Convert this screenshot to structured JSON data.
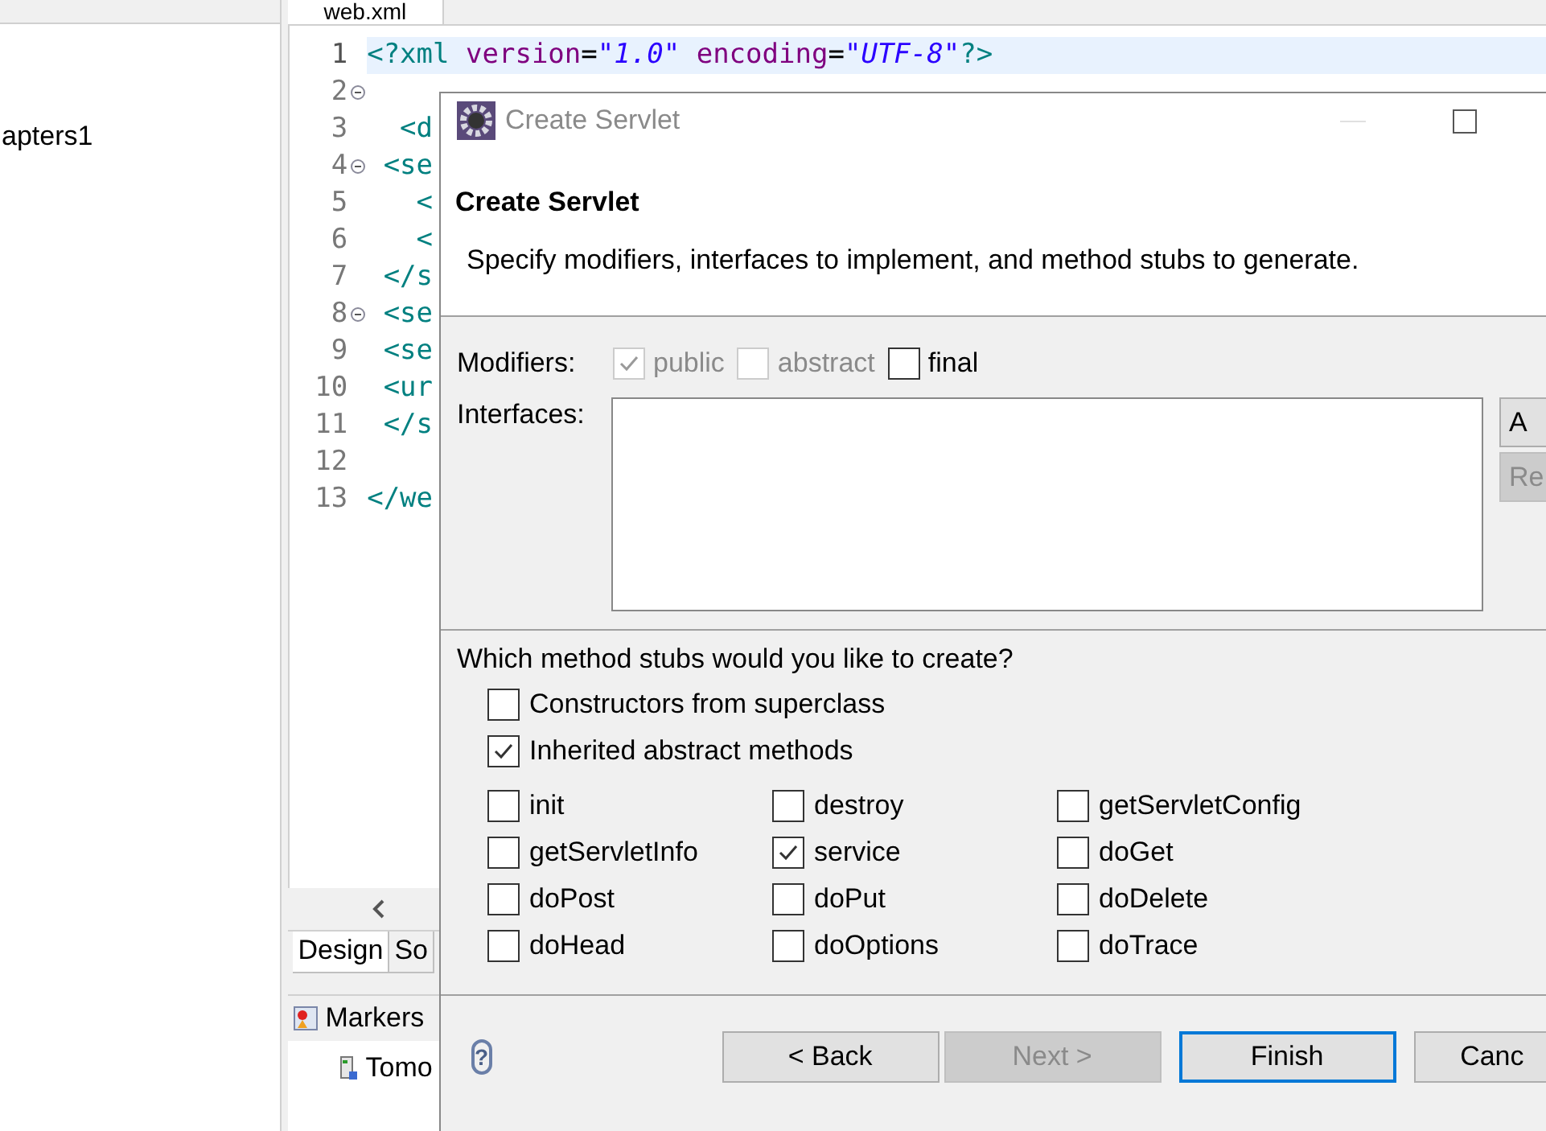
{
  "explorer": {
    "items": [
      {
        "label": "apters1"
      }
    ]
  },
  "editor": {
    "tab": "web.xml",
    "lines": [
      {
        "number": "1",
        "current": true,
        "fold": false,
        "segments": [
          {
            "kind": "tag",
            "text": "<?xml"
          },
          {
            "kind": "attr",
            "text": " version"
          },
          {
            "kind": "plain",
            "text": "="
          },
          {
            "kind": "value",
            "text": "\"1.0\""
          },
          {
            "kind": "attr",
            "text": " encoding"
          },
          {
            "kind": "plain",
            "text": "="
          },
          {
            "kind": "value",
            "text": "\"UTF-8\""
          },
          {
            "kind": "tag",
            "text": "?>"
          }
        ]
      },
      {
        "number": "2",
        "current": false,
        "fold": true
      },
      {
        "number": "3",
        "current": false,
        "fold": false,
        "segments": [
          {
            "kind": "tag",
            "text": "  <d"
          }
        ]
      },
      {
        "number": "4",
        "current": false,
        "fold": true,
        "segments": [
          {
            "kind": "tag",
            "text": " <se"
          }
        ]
      },
      {
        "number": "5",
        "current": false,
        "fold": false,
        "segments": [
          {
            "kind": "tag",
            "text": "   <"
          }
        ]
      },
      {
        "number": "6",
        "current": false,
        "fold": false,
        "segments": [
          {
            "kind": "tag",
            "text": "   <"
          }
        ]
      },
      {
        "number": "7",
        "current": false,
        "fold": false,
        "segments": [
          {
            "kind": "tag",
            "text": " </s"
          }
        ]
      },
      {
        "number": "8",
        "current": false,
        "fold": true,
        "segments": [
          {
            "kind": "tag",
            "text": " <se"
          }
        ]
      },
      {
        "number": "9",
        "current": false,
        "fold": false,
        "segments": [
          {
            "kind": "tag",
            "text": " <se"
          }
        ]
      },
      {
        "number": "10",
        "current": false,
        "fold": false,
        "segments": [
          {
            "kind": "tag",
            "text": " <ur"
          }
        ]
      },
      {
        "number": "11",
        "current": false,
        "fold": false,
        "segments": [
          {
            "kind": "tag",
            "text": " </s"
          }
        ]
      },
      {
        "number": "12",
        "current": false,
        "fold": false
      },
      {
        "number": "13",
        "current": false,
        "fold": false,
        "segments": [
          {
            "kind": "tag",
            "text": "</we"
          }
        ]
      }
    ],
    "bottom_tabs": [
      {
        "label": "Design",
        "selected": true
      },
      {
        "label": "So",
        "selected": false
      }
    ]
  },
  "markers_panel": {
    "title": "Markers",
    "items": [
      {
        "label": "Tomo"
      }
    ]
  },
  "dialog": {
    "title": "Create Servlet",
    "header_title": "Create Servlet",
    "description": "Specify modifiers, interfaces to implement, and method stubs to generate.",
    "modifiers_label": "Modifiers:",
    "modifiers": [
      {
        "label": "public",
        "checked": true,
        "disabled": true
      },
      {
        "label": "abstract",
        "checked": false,
        "disabled": true
      },
      {
        "label": "final",
        "checked": false,
        "disabled": false
      }
    ],
    "interfaces_label": "Interfaces:",
    "side_buttons": [
      {
        "label": "A",
        "disabled": false
      },
      {
        "label": "Re",
        "disabled": true
      }
    ],
    "question": "Which method stubs would you like to create?",
    "stubs": [
      {
        "label": "Constructors from superclass",
        "checked": false
      },
      {
        "label": "Inherited abstract methods",
        "checked": true
      }
    ],
    "methods": [
      {
        "label": "init",
        "checked": false
      },
      {
        "label": "destroy",
        "checked": false
      },
      {
        "label": "getServletConfig",
        "checked": false
      },
      {
        "label": "getServletInfo",
        "checked": false
      },
      {
        "label": "service",
        "checked": true
      },
      {
        "label": "doGet",
        "checked": false
      },
      {
        "label": "doPost",
        "checked": false
      },
      {
        "label": "doPut",
        "checked": false
      },
      {
        "label": "doDelete",
        "checked": false
      },
      {
        "label": "doHead",
        "checked": false
      },
      {
        "label": "doOptions",
        "checked": false
      },
      {
        "label": "doTrace",
        "checked": false
      }
    ],
    "help": "?",
    "buttons": [
      {
        "label": "< Back",
        "disabled": false,
        "default": false
      },
      {
        "label": "Next >",
        "disabled": true,
        "default": false
      },
      {
        "label": "Finish",
        "disabled": false,
        "default": true
      },
      {
        "label": "Canc",
        "disabled": false,
        "default": false
      }
    ]
  }
}
